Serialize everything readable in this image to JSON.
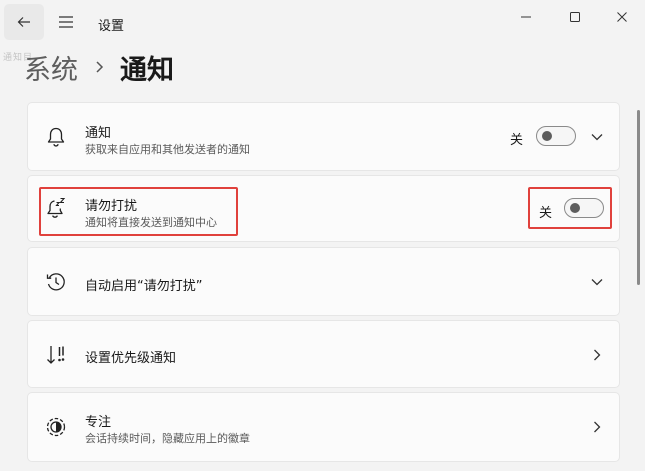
{
  "window": {
    "title": "设置",
    "ghost_text": "通知目"
  },
  "breadcrumb": {
    "parent": "系统",
    "current": "通知"
  },
  "cards": {
    "notifications": {
      "title": "通知",
      "desc": "获取来自应用和其他发送者的通知",
      "state_label": "关",
      "toggle_on": false
    },
    "dnd": {
      "title": "请勿打扰",
      "desc": "通知将直接发送到通知中心",
      "state_label": "关",
      "toggle_on": false
    },
    "auto_dnd": {
      "title": "自动启用“请勿打扰”"
    },
    "priority": {
      "title": "设置优先级通知"
    },
    "focus": {
      "title": "专注",
      "desc": "会话持续时间，隐藏应用上的徽章"
    }
  },
  "icons": {
    "back": "back-arrow-icon",
    "menu": "hamburger-menu-icon",
    "minimize": "minimize-icon",
    "maximize": "maximize-icon",
    "close": "close-icon",
    "notifications": "bell-icon",
    "dnd": "bell-zzz-icon",
    "auto_dnd": "clock-icon",
    "priority": "priority-sort-icon",
    "focus": "focus-icon"
  },
  "colors": {
    "highlight_box": "#e0413c",
    "background": "#f3f3f3",
    "card": "#fbfbfb"
  }
}
